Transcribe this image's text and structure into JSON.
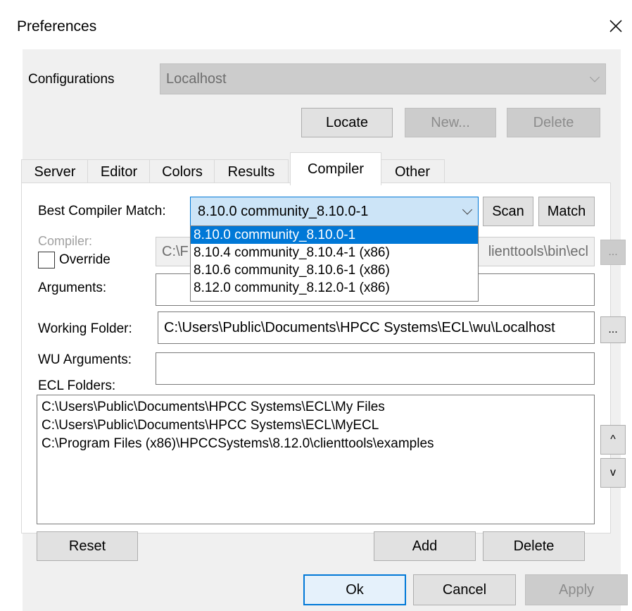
{
  "window": {
    "title": "Preferences",
    "close_glyph": "×",
    "close_icon": "close-icon"
  },
  "configurations": {
    "label": "Configurations",
    "value": "Localhost"
  },
  "buttons": {
    "locate": "Locate",
    "new": "New...",
    "delete_config": "Delete",
    "scan": "Scan",
    "match": "Match",
    "ellipsis": "...",
    "up": "^",
    "down": "v",
    "reset": "Reset",
    "add": "Add",
    "delete_folder": "Delete",
    "ok": "Ok",
    "cancel": "Cancel",
    "apply": "Apply"
  },
  "tabs": [
    {
      "label": "Server"
    },
    {
      "label": "Editor"
    },
    {
      "label": "Colors"
    },
    {
      "label": "Results"
    },
    {
      "label": "Compiler"
    },
    {
      "label": "Other"
    }
  ],
  "active_tab": "Compiler",
  "compiler": {
    "best_match_label": "Best Compiler Match:",
    "best_match_value": "8.10.0 community_8.10.0-1",
    "options": [
      "8.10.0 community_8.10.0-1",
      "8.10.4 community_8.10.4-1 (x86)",
      "8.10.6 community_8.10.6-1 (x86)",
      "8.12.0 community_8.12.0-1 (x86)"
    ],
    "compiler_label": "Compiler:",
    "compiler_path_start": "C:\\F",
    "compiler_path_end": "lienttools\\bin\\ecl",
    "override_label": "Override",
    "arguments_label": "Arguments:",
    "arguments_value": "",
    "working_folder_label": "Working Folder:",
    "working_folder_value": "C:\\Users\\Public\\Documents\\HPCC Systems\\ECL\\wu\\Localhost",
    "wu_arguments_label": "WU Arguments:",
    "wu_arguments_value": "",
    "ecl_folders_label": "ECL Folders:",
    "ecl_folders": [
      "C:\\Users\\Public\\Documents\\HPCC Systems\\ECL\\My Files",
      "C:\\Users\\Public\\Documents\\HPCC Systems\\ECL\\MyECL",
      "C:\\Program Files (x86)\\HPCCSystems\\8.12.0\\clienttools\\examples"
    ]
  },
  "colors": {
    "accent": "#0078d7",
    "dialog_bg": "#f0f0f0",
    "disabled_bg": "#cccccc"
  }
}
